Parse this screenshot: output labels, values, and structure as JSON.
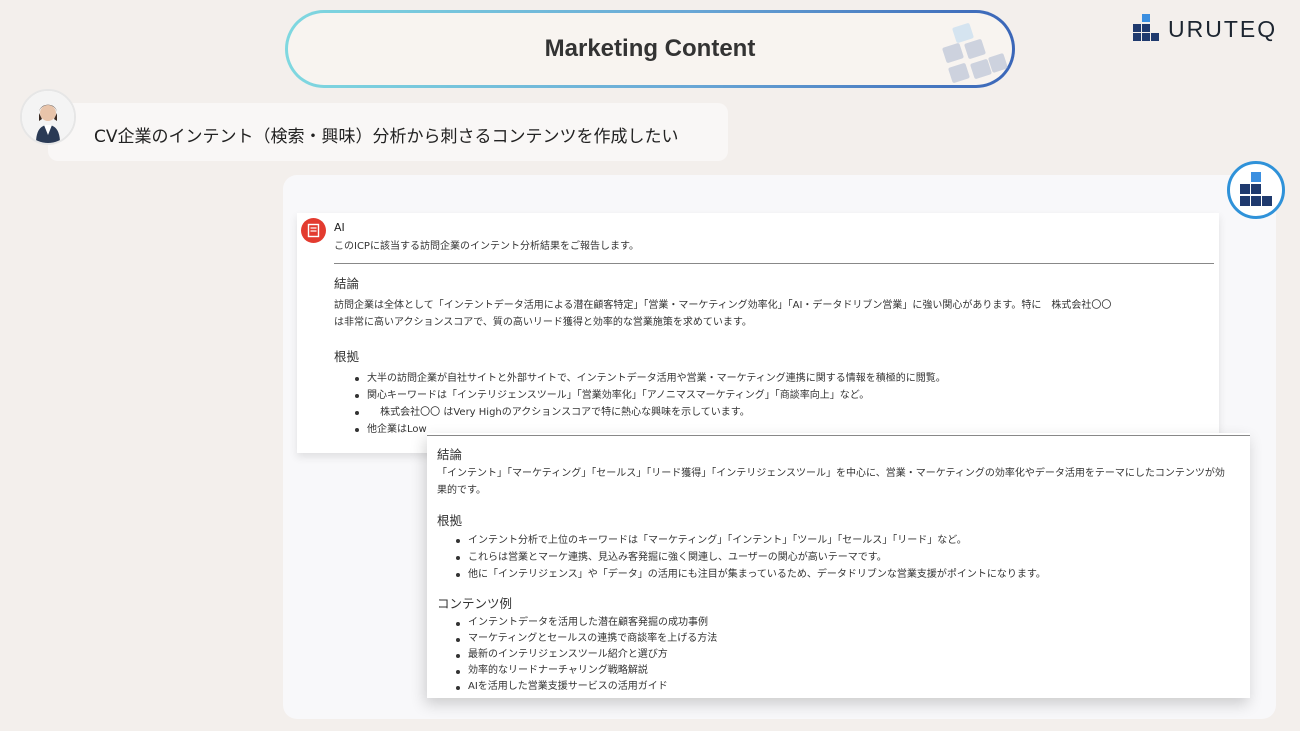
{
  "header": {
    "title": "Marketing Content",
    "brand": "URUTEQ"
  },
  "prompt": {
    "text": "CV企業のインテント（検索・興味）分析から刺さるコンテンツを作成したい"
  },
  "response1": {
    "sender": "AI",
    "intro": "このICPに該当する訪問企業のインテント分析結果をご報告します。",
    "conclusion_heading": "結論",
    "conclusion_line1": "訪問企業は全体として「インテントデータ活用による潜在顧客特定」「営業・マーケティング効率化」「AI・データドリブン営業」に強い関心があります。特に　株式会社〇〇",
    "conclusion_line2": "は非常に高いアクションスコアで、質の高いリード獲得と効率的な営業施策を求めています。",
    "evidence_heading": "根拠",
    "evidence": [
      "大半の訪問企業が自社サイトと外部サイトで、インテントデータ活用や営業・マーケティング連携に関する情報を積極的に閲覧。",
      "関心キーワードは「インテリジェンスツール」「営業効率化」「アノニマスマーケティング」「商談率向上」など。",
      "　 株式会社〇〇 はVery Highのアクションスコアで特に熱心な興味を示しています。",
      "他企業はLow"
    ]
  },
  "response2": {
    "conclusion_heading": "結論",
    "conclusion_line1": "「インテント」「マーケティング」「セールス」「リード獲得」「インテリジェンスツール」を中心に、営業・マーケティングの効率化やデータ活用をテーマにしたコンテンツが効",
    "conclusion_line2": "果的です。",
    "evidence_heading": "根拠",
    "evidence": [
      "インテント分析で上位のキーワードは「マーケティング」「インテント」「ツール」「セールス」「リード」など。",
      "これらは営業とマーケ連携、見込み客発掘に強く関連し、ユーザーの関心が高いテーマです。",
      "他に「インテリジェンス」や「データ」の活用にも注目が集まっているため、データドリブンな営業支援がポイントになります。"
    ],
    "examples_heading": "コンテンツ例",
    "examples": [
      "インテントデータを活用した潜在顧客発掘の成功事例",
      "マーケティングとセールスの連携で商談率を上げる方法",
      "最新のインテリジェンスツール紹介と選び方",
      "効率的なリードナーチャリング戦略解説",
      "AIを活用した営業支援サービスの活用ガイド"
    ]
  },
  "colors": {
    "background": "#f3efec",
    "brand_navy": "#1f3a6e",
    "accent_blue": "#2f92d9",
    "ai_badge_red": "#e33b2f"
  },
  "icons": {
    "brand_logo": "stacked-blocks-icon",
    "title_decoration": "stacked-blocks-icon",
    "assistant_avatar": "stacked-blocks-icon",
    "ai_badge": "document-icon",
    "user_avatar": "person-avatar"
  }
}
